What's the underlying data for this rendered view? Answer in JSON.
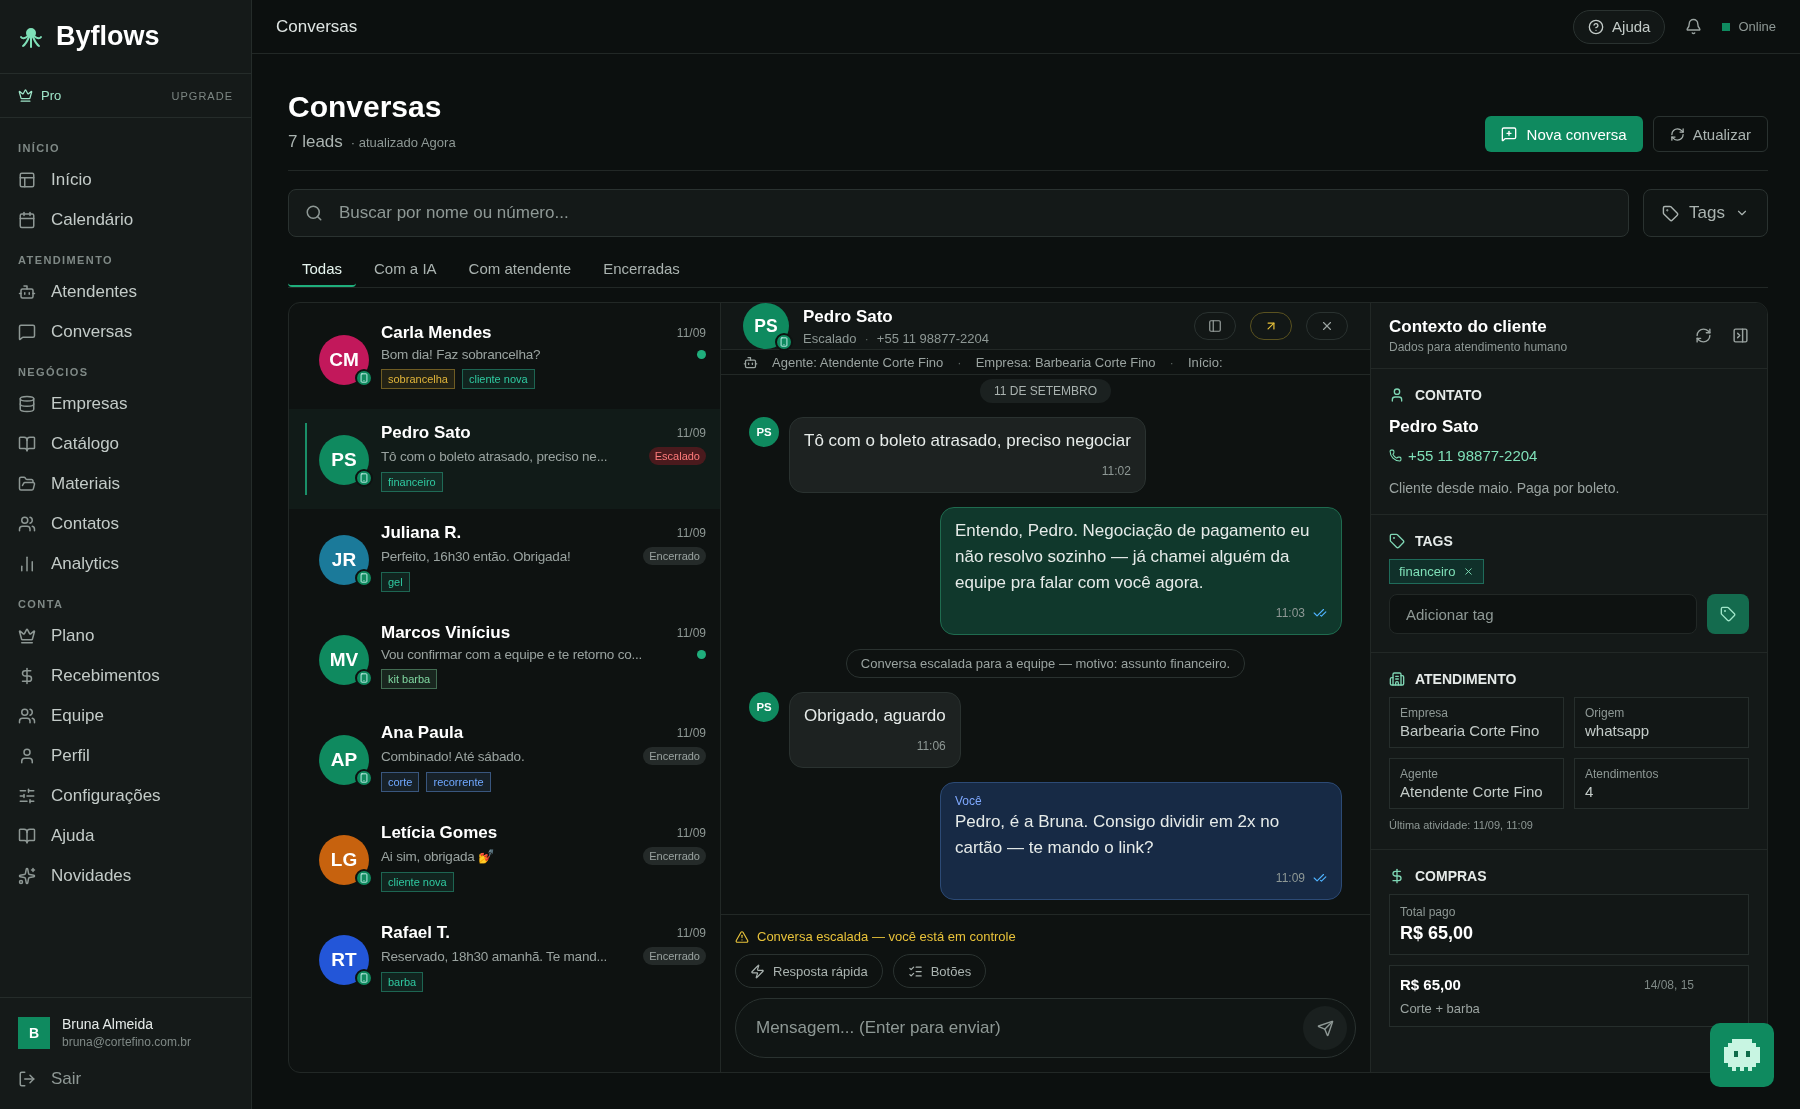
{
  "sidebar": {
    "brand": "Byflows",
    "plan": {
      "label": "Pro",
      "action": "UPGRADE"
    },
    "sections": [
      {
        "title": "INÍCIO",
        "items": [
          "Início",
          "Calendário"
        ]
      },
      {
        "title": "ATENDIMENTO",
        "items": [
          "Atendentes",
          "Conversas"
        ]
      },
      {
        "title": "NEGÓCIOS",
        "items": [
          "Empresas",
          "Catálogo",
          "Materiais",
          "Contatos",
          "Analytics"
        ]
      },
      {
        "title": "CONTA",
        "items": [
          "Plano",
          "Recebimentos",
          "Equipe",
          "Perfil",
          "Configurações",
          "Ajuda",
          "Novidades"
        ]
      }
    ],
    "user": {
      "initial": "B",
      "name": "Bruna Almeida",
      "email": "bruna@cortefino.com.br"
    },
    "logout": "Sair"
  },
  "topbar": {
    "title": "Conversas",
    "help": "Ajuda",
    "status": "Online"
  },
  "header": {
    "title": "Conversas",
    "count": "7 leads",
    "updated": "· atualizado Agora",
    "primary": "Nova conversa",
    "secondary": "Atualizar"
  },
  "search": {
    "placeholder": "Buscar por nome ou número...",
    "filter": "Tags"
  },
  "tabs": [
    {
      "label": "Todas",
      "selected": true
    },
    {
      "label": "Com a IA",
      "selected": false
    },
    {
      "label": "Com atendente",
      "selected": false
    },
    {
      "label": "Encerradas",
      "selected": false
    }
  ],
  "conversations": [
    {
      "initials": "CM",
      "color": "#c2185b",
      "name": "Carla Mendes",
      "date": "11/09",
      "preview": "Bom dia! Faz sobrancelha?",
      "unread": true,
      "selected": false,
      "tags": [
        {
          "label": "sobrancelha",
          "color": "#e0b43a"
        },
        {
          "label": "cliente nova",
          "color": "#2fc9a0"
        }
      ]
    },
    {
      "initials": "PS",
      "color": "#0f8a5f",
      "name": "Pedro Sato",
      "date": "11/09",
      "preview": "Tô com o boleto atrasado, preciso ne...",
      "unread": false,
      "selected": true,
      "status": {
        "kind": "escalated",
        "label": "Escalado"
      },
      "tags": [
        {
          "label": "financeiro",
          "color": "#2fc9a0"
        }
      ]
    },
    {
      "initials": "JR",
      "color": "#1b7a9a",
      "name": "Juliana R.",
      "date": "11/09",
      "preview": "Perfeito, 16h30 então. Obrigada!",
      "unread": false,
      "selected": false,
      "status": {
        "kind": "closed",
        "label": "Encerrado"
      },
      "tags": [
        {
          "label": "gel",
          "color": "#2fc9a0"
        }
      ]
    },
    {
      "initials": "MV",
      "color": "#0f8a5f",
      "name": "Marcos Vinícius",
      "date": "11/09",
      "preview": "Vou confirmar com a equipe e te retorno co...",
      "unread": true,
      "selected": false,
      "tags": [
        {
          "label": "kit barba",
          "color": "#7fd6a0"
        }
      ]
    },
    {
      "initials": "AP",
      "color": "#0f8a5f",
      "name": "Ana Paula",
      "date": "11/09",
      "preview": "Combinado! Até sábado.",
      "unread": false,
      "selected": false,
      "status": {
        "kind": "closed",
        "label": "Encerrado"
      },
      "tags": [
        {
          "label": "corte",
          "color": "#6fa8ff"
        },
        {
          "label": "recorrente",
          "color": "#6fa8ff"
        }
      ]
    },
    {
      "initials": "LG",
      "color": "#c7620e",
      "name": "Letícia Gomes",
      "date": "11/09",
      "preview": "Ai sim, obrigada 💅",
      "unread": false,
      "selected": false,
      "status": {
        "kind": "closed",
        "label": "Encerrado"
      },
      "tags": [
        {
          "label": "cliente nova",
          "color": "#2fc9a0"
        }
      ]
    },
    {
      "initials": "RT",
      "color": "#2356d8",
      "name": "Rafael T.",
      "date": "11/09",
      "preview": "Reservado, 18h30 amanhã. Te mand...",
      "unread": false,
      "selected": false,
      "status": {
        "kind": "closed",
        "label": "Encerrado"
      },
      "tags": [
        {
          "label": "barba",
          "color": "#2fc9a0"
        }
      ]
    }
  ],
  "chat": {
    "initials": "PS",
    "name": "Pedro Sato",
    "status": "Escalado",
    "separator": "·",
    "phone": "+55 11 98877-2204",
    "info": [
      "Agente: Atendente Corte Fino",
      "Empresa: Barbearia Corte Fino",
      "Início:"
    ],
    "date_divider": "11 DE SETEMBRO",
    "messages": [
      {
        "kind": "incoming",
        "initials": "PS",
        "text": "Tô com o boleto atrasado, preciso negociar",
        "time": "11:02"
      },
      {
        "kind": "outgoing",
        "text": "Entendo, Pedro. Negociação de pagamento eu não resolvo sozinho — já chamei alguém da equipe pra falar com você agora.",
        "time": "11:03",
        "read": true
      },
      {
        "kind": "system",
        "text": "Conversa escalada para a equipe — motivo: assunto financeiro."
      },
      {
        "kind": "incoming",
        "initials": "PS",
        "text": "Obrigado, aguardo",
        "time": "11:06"
      },
      {
        "kind": "agent",
        "sender": "Você",
        "text": "Pedro, é a Bruna. Consigo dividir em 2x no cartão — te mando o link?",
        "time": "11:09",
        "read": true
      }
    ],
    "warning": "Conversa escalada — você está em controle",
    "quick_actions": [
      "Resposta rápida",
      "Botões"
    ],
    "placeholder": "Mensagem... (Enter para enviar)"
  },
  "context": {
    "title": "Contexto do cliente",
    "subtitle": "Dados para atendimento humano",
    "contact": {
      "heading": "CONTATO",
      "name": "Pedro Sato",
      "phone": "+55 11 98877-2204",
      "note": "Cliente desde maio. Paga por boleto."
    },
    "tags": {
      "heading": "TAGS",
      "items": [
        "financeiro"
      ],
      "placeholder": "Adicionar tag"
    },
    "service": {
      "heading": "ATENDIMENTO",
      "fields": [
        {
          "label": "Empresa",
          "value": "Barbearia Corte Fino"
        },
        {
          "label": "Origem",
          "value": "whatsapp"
        },
        {
          "label": "Agente",
          "value": "Atendente Corte Fino"
        },
        {
          "label": "Atendimentos",
          "value": "4"
        }
      ],
      "last_activity": "Última atividade: 11/09, 11:09"
    },
    "purchases": {
      "heading": "COMPRAS",
      "total_label": "Total pago",
      "total": "R$ 65,00",
      "items": [
        {
          "amount": "R$ 65,00",
          "date": "14/08, 15",
          "description": "Corte + barba"
        }
      ]
    }
  }
}
